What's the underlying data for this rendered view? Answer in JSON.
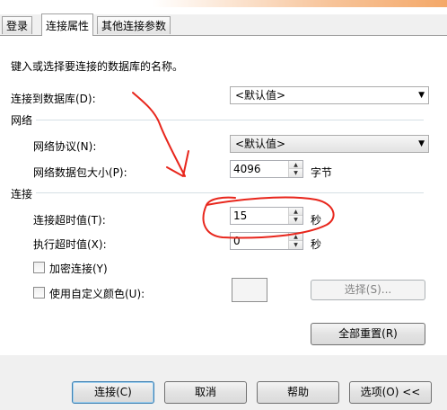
{
  "tabs": [
    {
      "label": "登录",
      "active": false
    },
    {
      "label": "连接属性",
      "active": true
    },
    {
      "label": "其他连接参数",
      "active": false
    }
  ],
  "instructions": "键入或选择要连接的数据库的名称。",
  "database": {
    "label": "连接到数据库(D):",
    "value": "<默认值>"
  },
  "network": {
    "group_title": "网络",
    "protocol_label": "网络协议(N):",
    "protocol_value": "<默认值>",
    "packet_label": "网络数据包大小(P):",
    "packet_value": "4096",
    "packet_unit": "字节"
  },
  "connection": {
    "group_title": "连接",
    "timeout_label": "连接超时值(T):",
    "timeout_value": "15",
    "timeout_unit": "秒",
    "exec_label": "执行超时值(X):",
    "exec_value": "0",
    "exec_unit": "秒",
    "encrypt_label": "加密连接(Y)",
    "encrypt_checked": false,
    "custom_color_label": "使用自定义颜色(U):",
    "custom_color_checked": false,
    "select_button": "选择(S)...",
    "reset_button": "全部重置(R)"
  },
  "footer": {
    "connect": "连接(C)",
    "cancel": "取消",
    "help": "帮助",
    "options": "选项(O) <<"
  },
  "annotation_color": "#e8261c",
  "icons": {
    "dropdown": "chevron-down-icon",
    "spin_up": "spin-up-icon",
    "spin_down": "spin-down-icon"
  }
}
